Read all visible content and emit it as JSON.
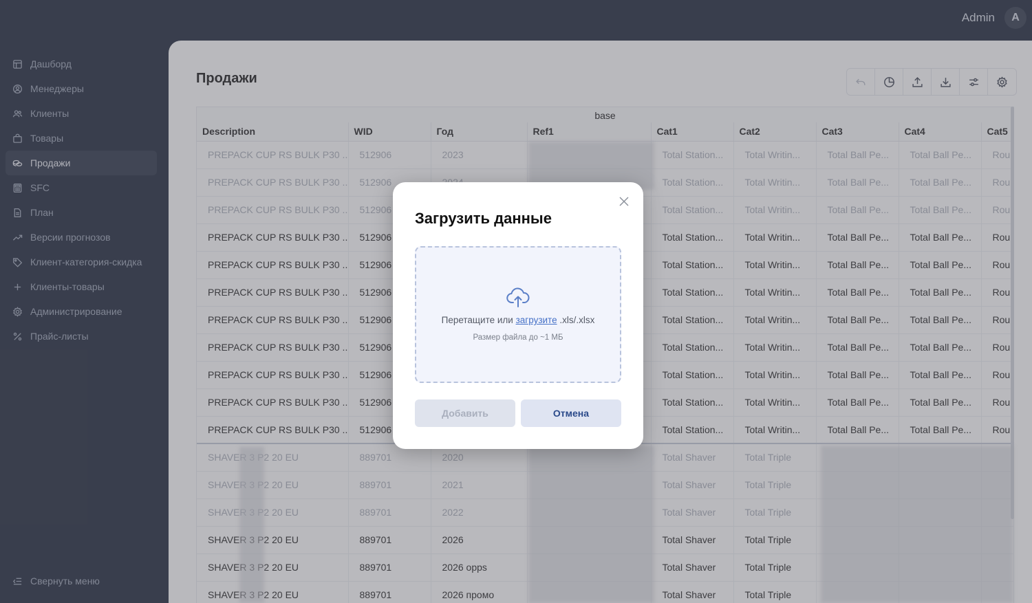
{
  "user": {
    "name": "Admin",
    "initial": "A"
  },
  "sidebar": {
    "items": [
      {
        "label": "Дашборд",
        "icon": "dashboard-icon",
        "active": false
      },
      {
        "label": "Менеджеры",
        "icon": "user-circle-icon",
        "active": false
      },
      {
        "label": "Клиенты",
        "icon": "users-icon",
        "active": false
      },
      {
        "label": "Товары",
        "icon": "bag-icon",
        "active": false
      },
      {
        "label": "Продажи",
        "icon": "coins-icon",
        "active": true
      },
      {
        "label": "SFC",
        "icon": "calculator-icon",
        "active": false
      },
      {
        "label": "План",
        "icon": "document-icon",
        "active": false
      },
      {
        "label": "Версии прогнозов",
        "icon": "trend-icon",
        "active": false
      },
      {
        "label": "Клиент-категория-скидка",
        "icon": "tag-icon",
        "active": false
      },
      {
        "label": "Клиенты-товары",
        "icon": "plus-icon",
        "active": false
      },
      {
        "label": "Администрирование",
        "icon": "gear-icon",
        "active": false
      },
      {
        "label": "Прайс-листы",
        "icon": "percent-icon",
        "active": false
      }
    ],
    "collapse_label": "Свернуть меню"
  },
  "page": {
    "title": "Продажи"
  },
  "toolbar": [
    {
      "name": "undo-button",
      "icon": "undo-icon"
    },
    {
      "name": "chart-button",
      "icon": "pie-chart-icon"
    },
    {
      "name": "upload-button",
      "icon": "upload-icon"
    },
    {
      "name": "download-button",
      "icon": "download-icon"
    },
    {
      "name": "filter-button",
      "icon": "sliders-icon"
    },
    {
      "name": "settings-button",
      "icon": "gear-icon"
    }
  ],
  "table": {
    "group_header": "base",
    "columns": [
      "Description",
      "WID",
      "Год",
      "Ref1",
      "Cat1",
      "Cat2",
      "Cat3",
      "Cat4",
      "Cat5"
    ],
    "rows": [
      [
        "PREPACK CUP RS BULK P30 ...",
        "512906",
        "2023",
        "",
        "Total Station...",
        "Total Writin...",
        "Total Ball Pe...",
        "Total Ball Pe...",
        "Round"
      ],
      [
        "PREPACK CUP RS BULK P30 ...",
        "512906",
        "2024",
        "",
        "Total Station...",
        "Total Writin...",
        "Total Ball Pe...",
        "Total Ball Pe...",
        "Round"
      ],
      [
        "PREPACK CUP RS BULK P30 ...",
        "512906",
        "",
        "",
        "Total Station...",
        "Total Writin...",
        "Total Ball Pe...",
        "Total Ball Pe...",
        "Round"
      ],
      [
        "PREPACK CUP RS BULK P30 ...",
        "512906",
        "",
        "",
        "Total Station...",
        "Total Writin...",
        "Total Ball Pe...",
        "Total Ball Pe...",
        "Round"
      ],
      [
        "PREPACK CUP RS BULK P30 ...",
        "512906",
        "",
        "",
        "Total Station...",
        "Total Writin...",
        "Total Ball Pe...",
        "Total Ball Pe...",
        "Round"
      ],
      [
        "PREPACK CUP RS BULK P30 ...",
        "512906",
        "",
        "",
        "Total Station...",
        "Total Writin...",
        "Total Ball Pe...",
        "Total Ball Pe...",
        "Round"
      ],
      [
        "PREPACK CUP RS BULK P30 ...",
        "512906",
        "",
        "",
        "Total Station...",
        "Total Writin...",
        "Total Ball Pe...",
        "Total Ball Pe...",
        "Round"
      ],
      [
        "PREPACK CUP RS BULK P30 ...",
        "512906",
        "",
        "",
        "Total Station...",
        "Total Writin...",
        "Total Ball Pe...",
        "Total Ball Pe...",
        "Round"
      ],
      [
        "PREPACK CUP RS BULK P30 ...",
        "512906",
        "",
        "",
        "Total Station...",
        "Total Writin...",
        "Total Ball Pe...",
        "Total Ball Pe...",
        "Round"
      ],
      [
        "PREPACK CUP RS BULK P30 ...",
        "512906",
        "",
        "",
        "Total Station...",
        "Total Writin...",
        "Total Ball Pe...",
        "Total Ball Pe...",
        "Round"
      ],
      [
        "PREPACK CUP RS BULK P30 ...",
        "512906",
        "",
        "",
        "Total Station...",
        "Total Writin...",
        "Total Ball Pe...",
        "Total Ball Pe...",
        "Round"
      ],
      [
        "SHAVER 3 P2 20 EU",
        "889701",
        "2020",
        "",
        "Total Shaver",
        "Total Triple",
        "",
        "",
        ""
      ],
      [
        "SHAVER 3 P2 20 EU",
        "889701",
        "2021",
        "",
        "Total Shaver",
        "Total Triple",
        "",
        "",
        ""
      ],
      [
        "SHAVER 3 P2 20 EU",
        "889701",
        "2022",
        "",
        "Total Shaver",
        "Total Triple",
        "",
        "",
        ""
      ],
      [
        "SHAVER 3 P2 20 EU",
        "889701",
        "2026",
        "",
        "Total Shaver",
        "Total Triple",
        "",
        "",
        ""
      ],
      [
        "SHAVER 3 P2 20 EU",
        "889701",
        "2026 opps",
        "",
        "Total Shaver",
        "Total Triple",
        "",
        "",
        ""
      ],
      [
        "SHAVER 3 P2 20 EU",
        "889701",
        "2026 промо",
        "",
        "Total Shaver",
        "Total Triple",
        "",
        "",
        ""
      ]
    ]
  },
  "modal": {
    "title": "Загрузить данные",
    "drop_prefix": "Перетащите или",
    "drop_link": "загрузите",
    "drop_suffix": ".xls/.xlsx",
    "hint": "Размер файла до ~1 МБ",
    "add_label": "Добавить",
    "cancel_label": "Отмена"
  }
}
